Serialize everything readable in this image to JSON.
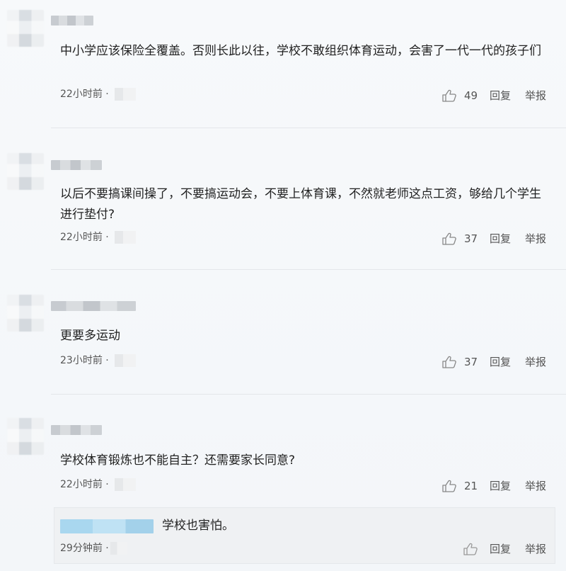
{
  "comments": [
    {
      "text": "中小学应该保险全覆盖。否则长此以往，学校不敢组织体育运动，会害了一代一代的孩子们",
      "time": "22小时前 · ",
      "likes": "49",
      "reply": "回复",
      "report": "举报"
    },
    {
      "text": "以后不要搞课间操了，不要搞运动会，不要上体育课，不然就老师这点工资，够给几个学生进行垫付?",
      "time": "22小时前 · ",
      "likes": "37",
      "reply": "回复",
      "report": "举报"
    },
    {
      "text": "更要多运动",
      "time": "23小时前 · ",
      "likes": "37",
      "reply": "回复",
      "report": "举报"
    },
    {
      "text": "学校体育锻炼也不能自主？还需要家长同意?",
      "time": "22小时前 · ",
      "likes": "21",
      "reply": "回复",
      "report": "举报"
    }
  ],
  "reply": {
    "text": "学校也害怕。",
    "time": "29分钟前 · ",
    "likes": "",
    "reply": "回复",
    "report": "举报"
  },
  "icons": {
    "like": "thumbs-up-icon"
  }
}
